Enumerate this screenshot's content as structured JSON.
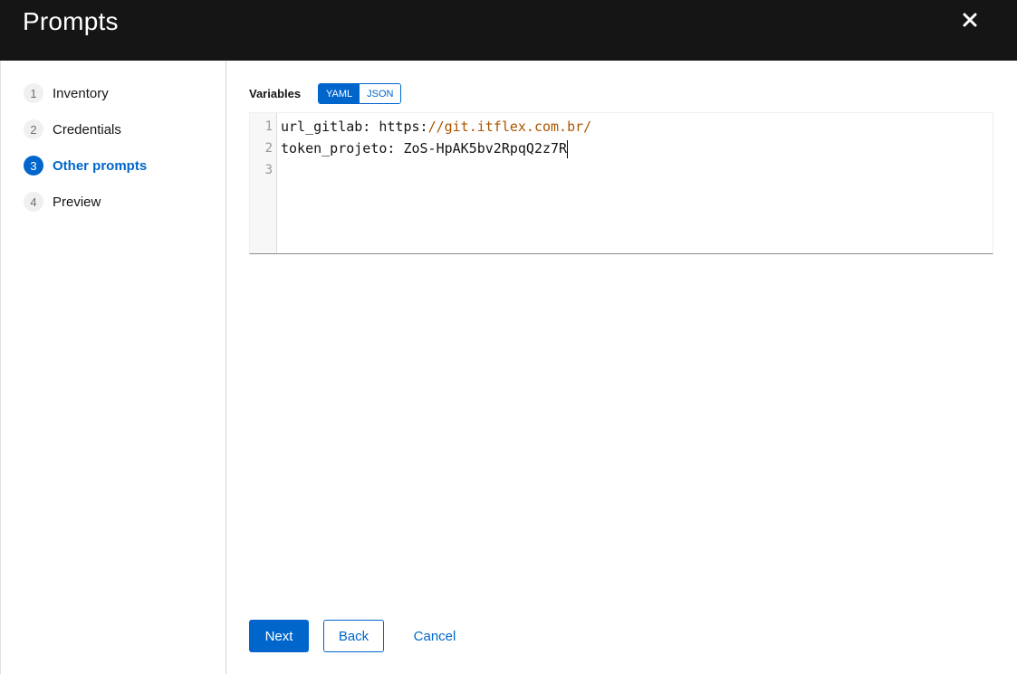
{
  "modal": {
    "title": "Prompts",
    "close_icon": "close-icon"
  },
  "wizard": {
    "steps": [
      {
        "number": "1",
        "label": "Inventory",
        "active": false
      },
      {
        "number": "2",
        "label": "Credentials",
        "active": false
      },
      {
        "number": "3",
        "label": "Other prompts",
        "active": true
      },
      {
        "number": "4",
        "label": "Preview",
        "active": false
      }
    ]
  },
  "variables": {
    "label": "Variables",
    "formats": [
      "YAML",
      "JSON"
    ],
    "selected_format": "YAML",
    "lines": [
      {
        "number": "1",
        "key": "url_gitlab: https:",
        "value": "//git.itflex.com.br/"
      },
      {
        "number": "2",
        "key": "token_projeto: ZoS-HpAK5bv2RpqQ2z7R",
        "value": ""
      },
      {
        "number": "3",
        "key": "",
        "value": ""
      }
    ]
  },
  "footer": {
    "next_label": "Next",
    "back_label": "Back",
    "cancel_label": "Cancel"
  },
  "colors": {
    "accent": "#0066cc",
    "header_bg": "#151515",
    "url_string": "#aa5500"
  }
}
